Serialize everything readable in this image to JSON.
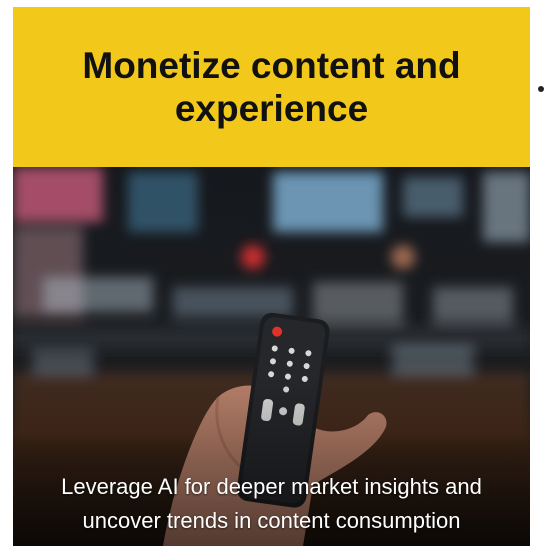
{
  "card": {
    "title": "Monetize content and experience",
    "caption": "Leverage AI for deeper market insights and uncover trends in content consumption"
  },
  "colors": {
    "header_bg": "#f2c81b",
    "title_text": "#111111",
    "caption_text": "#ffffff"
  },
  "icons": {
    "pager": "carousel-dot-icon"
  }
}
